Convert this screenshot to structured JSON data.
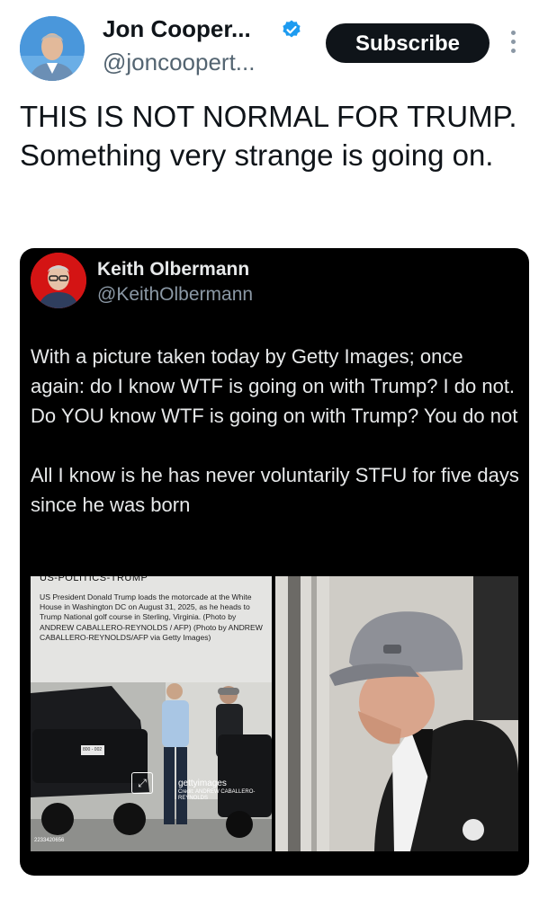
{
  "header": {
    "name": "Jon Cooper...",
    "handle": "@joncoopert...",
    "subscribe_label": "Subscribe"
  },
  "tweet": {
    "text": "THIS IS NOT NORMAL FOR TRUMP. Something very strange is going on."
  },
  "quote": {
    "name": "Keith Olbermann",
    "handle": "@KeithOlbermann",
    "paragraphs": [
      "With a picture taken today by Getty Images; once again: do I know WTF is going on with Trump? I do not. Do YOU know WTF is going on with Trump? You do not",
      "All I know is he has never voluntarily STFU for five days since he was born"
    ],
    "media": {
      "caption_title": "US-POLITICS-TRUMP",
      "caption": "US President Donald Trump loads the motorcade at the White House in Washington DC on August 31, 2025, as he heads to Trump National golf course in Sterling, Virginia. (Photo by ANDREW CABALLERO-REYNOLDS / AFP) (Photo by ANDREW CABALLERO-REYNOLDS/AFP via Getty Images)",
      "watermark": "gettyimages",
      "watermark_credit": "Credit: ANDREW CABALLERO-REYNOLDS",
      "plate": "800 - 002",
      "photo_id": "2233420656"
    }
  },
  "icons": {
    "verified": "verified-badge-icon",
    "more": "more-vertical-icon",
    "expand": "expand-arrows-icon"
  },
  "colors": {
    "verified_blue": "#1d9bf0",
    "subscribe_bg": "#0f1419",
    "quote_bg": "#000000",
    "handle_gray": "#536471"
  }
}
